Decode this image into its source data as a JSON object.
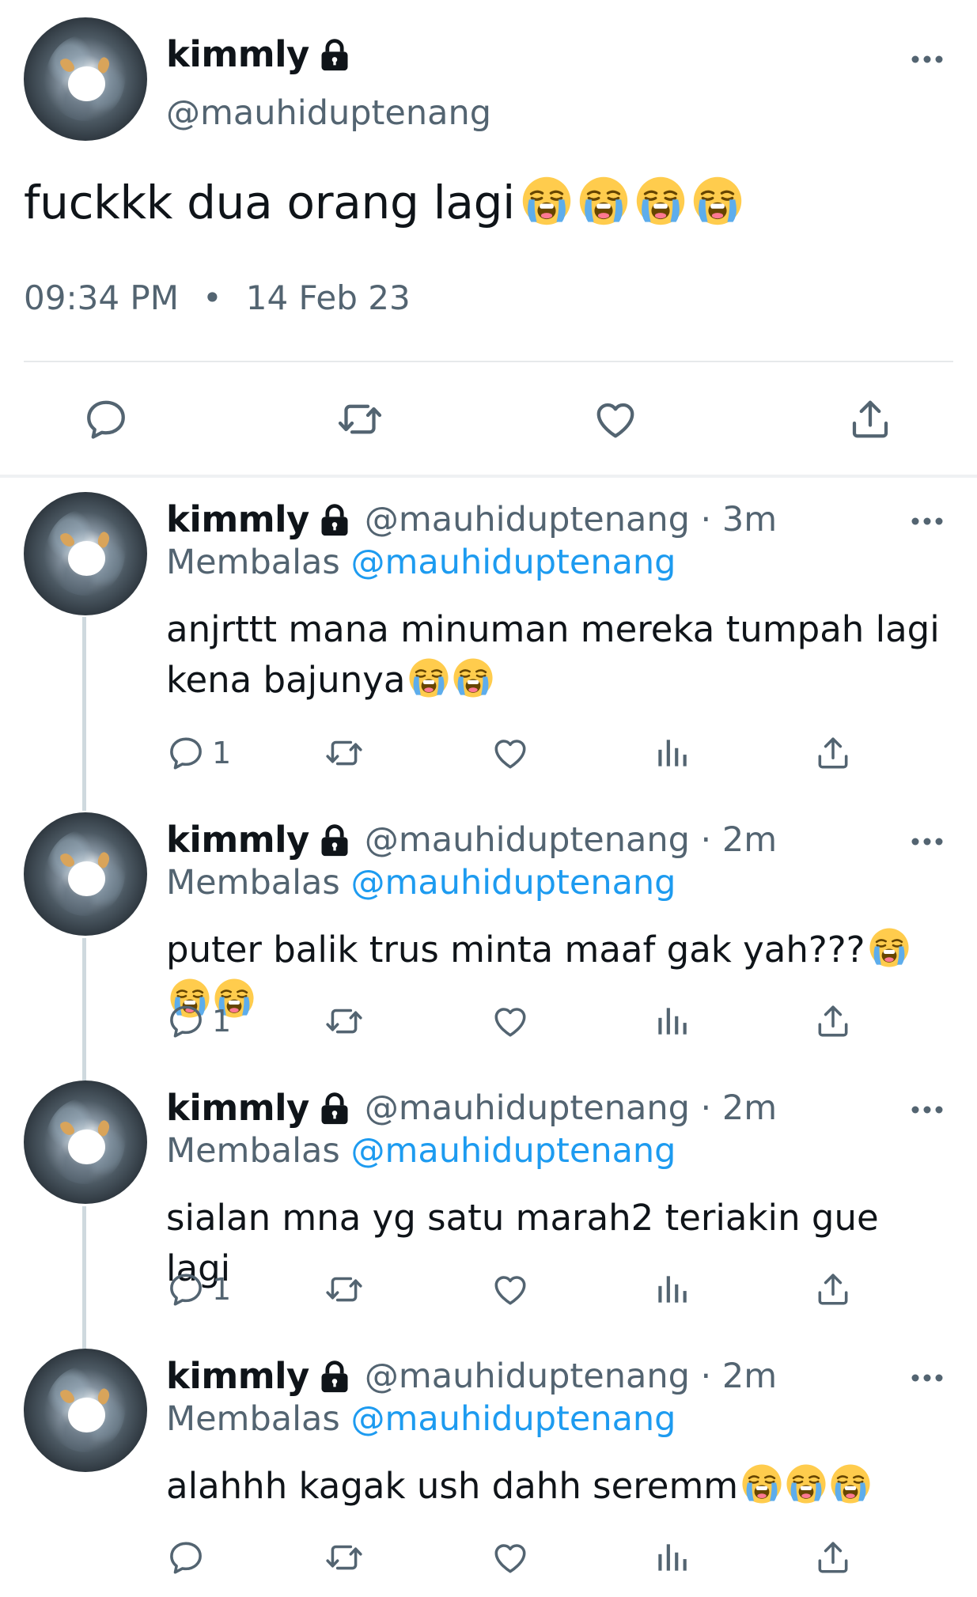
{
  "tweet": {
    "display_name": "kimmly",
    "handle": "@mauhiduptenang",
    "text": "fuckkk dua orang lagi",
    "emojis": [
      "loudly-crying-face",
      "loudly-crying-face",
      "loudly-crying-face",
      "loudly-crying-face"
    ],
    "time": "09:34 PM",
    "separator": "•",
    "date": "14 Feb 23",
    "icons": [
      "reply-icon",
      "retweet-icon",
      "like-icon",
      "share-icon",
      "more-icon",
      "lock-icon"
    ]
  },
  "replies": [
    {
      "display_name": "kimmly",
      "handle_time": "@mauhiduptenang · 3m",
      "reply_label": "Membalas",
      "reply_mention": "@mauhiduptenang",
      "text_line1": "anjrttt mana minuman mereka tumpah lagi",
      "text_line2": "kena bajunya",
      "emoji_count": 2,
      "reply_count": "1"
    },
    {
      "display_name": "kimmly",
      "handle_time": "@mauhiduptenang · 2m",
      "reply_label": "Membalas",
      "reply_mention": "@mauhiduptenang",
      "text_line1": "puter balik trus minta maaf gak yah???",
      "emoji_count": 3,
      "reply_count": "1"
    },
    {
      "display_name": "kimmly",
      "handle_time": "@mauhiduptenang · 2m",
      "reply_label": "Membalas",
      "reply_mention": "@mauhiduptenang",
      "text_line1": "sialan mna yg satu marah2 teriakin gue lagi",
      "emoji_count": 0,
      "reply_count": "1"
    },
    {
      "display_name": "kimmly",
      "handle_time": "@mauhiduptenang · 2m",
      "reply_label": "Membalas",
      "reply_mention": "@mauhiduptenang",
      "text_line1": "alahhh kagak ush dahh seremm",
      "emoji_count": 3,
      "reply_count": ""
    }
  ],
  "colors": {
    "text": "#0f1419",
    "secondary": "#536471",
    "link": "#1d9bf0",
    "divider": "#e6e9eb",
    "thread_line": "#cfd9de",
    "emoji_face": "#ffcc4d",
    "emoji_tears": "#5dadec"
  }
}
